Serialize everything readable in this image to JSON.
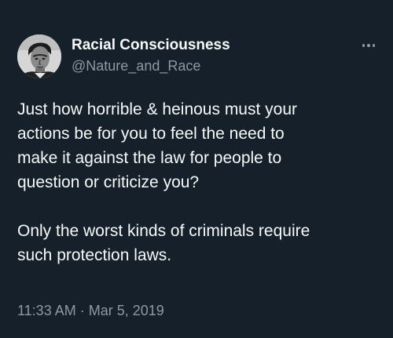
{
  "author": {
    "display_name": "Racial Consciousness",
    "handle": "@Nature_and_Race",
    "avatar_icon": "portrait-avatar-icon"
  },
  "menu": {
    "icon": "more-options-icon"
  },
  "tweet": {
    "paragraph_1": "Just how horrible & heinous must your\nactions be for you to feel the need to\nmake it against the law for people to\nquestion or criticize you?",
    "paragraph_2": "Only the worst kinds of criminals require\nsuch protection laws."
  },
  "meta": {
    "time": "11:33 AM",
    "separator": "·",
    "date": "Mar 5, 2019"
  },
  "colors": {
    "background": "#15202b",
    "text": "#f7f9f9",
    "secondary_text": "#8b98a5"
  }
}
